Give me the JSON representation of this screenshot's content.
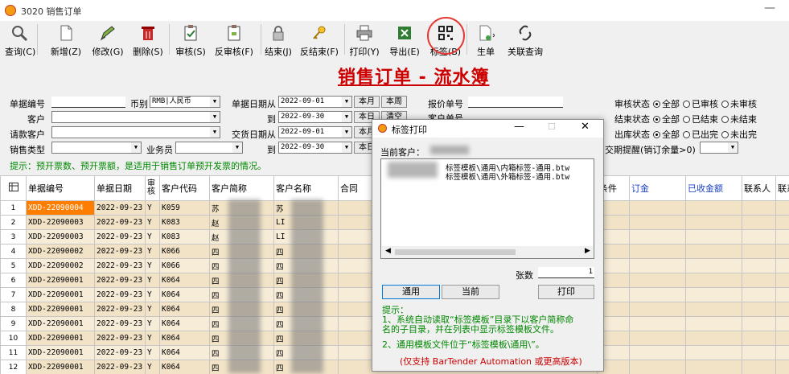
{
  "window": {
    "title": "3020 销售订单",
    "min": "—"
  },
  "toolbar": {
    "items": [
      {
        "label": "查询(C)",
        "icon": "search-icon"
      },
      {
        "label": "新增(Z)",
        "icon": "new-doc-icon"
      },
      {
        "label": "修改(G)",
        "icon": "edit-icon"
      },
      {
        "label": "删除(S)",
        "icon": "trash-icon"
      },
      {
        "label": "审核(S)",
        "icon": "approve-icon"
      },
      {
        "label": "反审核(F)",
        "icon": "unapprove-icon"
      },
      {
        "label": "结束(J)",
        "icon": "lock-icon"
      },
      {
        "label": "反结束(F)",
        "icon": "key-icon"
      },
      {
        "label": "打印(Y)",
        "icon": "printer-icon"
      },
      {
        "label": "导出(E)",
        "icon": "excel-icon"
      },
      {
        "label": "标签(B)",
        "icon": "qrcode-icon"
      },
      {
        "label": "生单",
        "icon": "generate-icon"
      },
      {
        "label": "关联查询",
        "icon": "link-icon"
      }
    ]
  },
  "page_title": "销售订单 - 流水簿",
  "form": {
    "order_no_label": "单据编号",
    "currency_label": "币别",
    "currency_value": "RMB|人民币",
    "doc_date_label": "单据日期从",
    "doc_date_from": "2022-09-01",
    "doc_date_to_label": "到",
    "doc_date_to": "2022-09-30",
    "this_month": "本月",
    "this_week": "本周",
    "today": "本日",
    "clear": "清空",
    "quote_no_label": "报价单号",
    "customer_order_label": "客户单号",
    "customer_label": "客户",
    "request_customer_label": "请款客户",
    "delivery_date_label": "交货日期从",
    "delivery_date_from": "2022-09-01",
    "delivery_date_to_label": "到",
    "delivery_date_to": "2022-09-30",
    "this_month2": "本月",
    "today2": "本日",
    "sales_type_label": "销售类型",
    "salesperson_label": "业务员",
    "audit_status_label": "审核状态",
    "audit_opts": [
      "全部",
      "已审核",
      "未审核"
    ],
    "end_status_label": "结束状态",
    "end_opts": [
      "全部",
      "已结束",
      "未结束"
    ],
    "stock_status_label": "出库状态",
    "stock_opts": [
      "全部",
      "已出完",
      "未出完"
    ],
    "due_label": "交期提醒(销订余量>0)"
  },
  "hint": "提示：预开票数、预开票额，是适用于销售订单预开发票的情况。",
  "grid": {
    "headers": [
      "",
      "单据编号",
      "单据日期",
      "审核",
      "客户代码",
      "客户简称",
      "客户名称",
      "合同"
    ],
    "right_headers": [
      "条件",
      "订金",
      "已收金额",
      "联系人",
      "联系"
    ],
    "rows": [
      {
        "n": "1",
        "no": "XDD-22090004",
        "date": "2022-09-23",
        "a": "Y",
        "code": "K059",
        "short": "苏",
        "name": "苏"
      },
      {
        "n": "2",
        "no": "XDD-22090003",
        "date": "2022-09-23",
        "a": "Y",
        "code": "K083",
        "short": "赵",
        "name": "LI"
      },
      {
        "n": "3",
        "no": "XDD-22090003",
        "date": "2022-09-23",
        "a": "Y",
        "code": "K083",
        "short": "赵",
        "name": "LI"
      },
      {
        "n": "4",
        "no": "XDD-22090002",
        "date": "2022-09-23",
        "a": "Y",
        "code": "K066",
        "short": "四",
        "name": "四"
      },
      {
        "n": "5",
        "no": "XDD-22090002",
        "date": "2022-09-23",
        "a": "Y",
        "code": "K066",
        "short": "四",
        "name": "四"
      },
      {
        "n": "6",
        "no": "XDD-22090001",
        "date": "2022-09-23",
        "a": "Y",
        "code": "K064",
        "short": "四",
        "name": "四"
      },
      {
        "n": "7",
        "no": "XDD-22090001",
        "date": "2022-09-23",
        "a": "Y",
        "code": "K064",
        "short": "四",
        "name": "四"
      },
      {
        "n": "8",
        "no": "XDD-22090001",
        "date": "2022-09-23",
        "a": "Y",
        "code": "K064",
        "short": "四",
        "name": "四"
      },
      {
        "n": "9",
        "no": "XDD-22090001",
        "date": "2022-09-23",
        "a": "Y",
        "code": "K064",
        "short": "四",
        "name": "四"
      },
      {
        "n": "10",
        "no": "XDD-22090001",
        "date": "2022-09-23",
        "a": "Y",
        "code": "K064",
        "short": "四",
        "name": "四"
      },
      {
        "n": "11",
        "no": "XDD-22090001",
        "date": "2022-09-23",
        "a": "Y",
        "code": "K064",
        "short": "四",
        "name": "四"
      },
      {
        "n": "12",
        "no": "XDD-22090001",
        "date": "2022-09-23",
        "a": "Y",
        "code": "K064",
        "short": "四",
        "name": "四"
      }
    ]
  },
  "dialog": {
    "title": "标签打印",
    "min": "—",
    "max": "☐",
    "close": "✕",
    "customer_label": "当前客户：",
    "files": [
      "标签模板\\通用\\内箱标签-通用.btw",
      "标签模板\\通用\\外箱标签-通用.btw"
    ],
    "copies_label": "张数",
    "copies_value": "1",
    "btn_general": "通用",
    "btn_current": "当前",
    "btn_print": "打印",
    "tips": [
      "提示：",
      "1、系统自动读取“标签模板”目录下以客户简称命",
      "名的子目录，并在列表中显示标签模板文件。",
      "2、通用模板文件位于“标签模板\\通用\\”。"
    ],
    "note": "(仅支持 BarTender Automation 或更高版本)"
  },
  "colors": {
    "accent_red": "#cc0000",
    "selected_row": "#ff7e00",
    "row_fill": "#f2e3c7",
    "hint_green": "#008800"
  }
}
